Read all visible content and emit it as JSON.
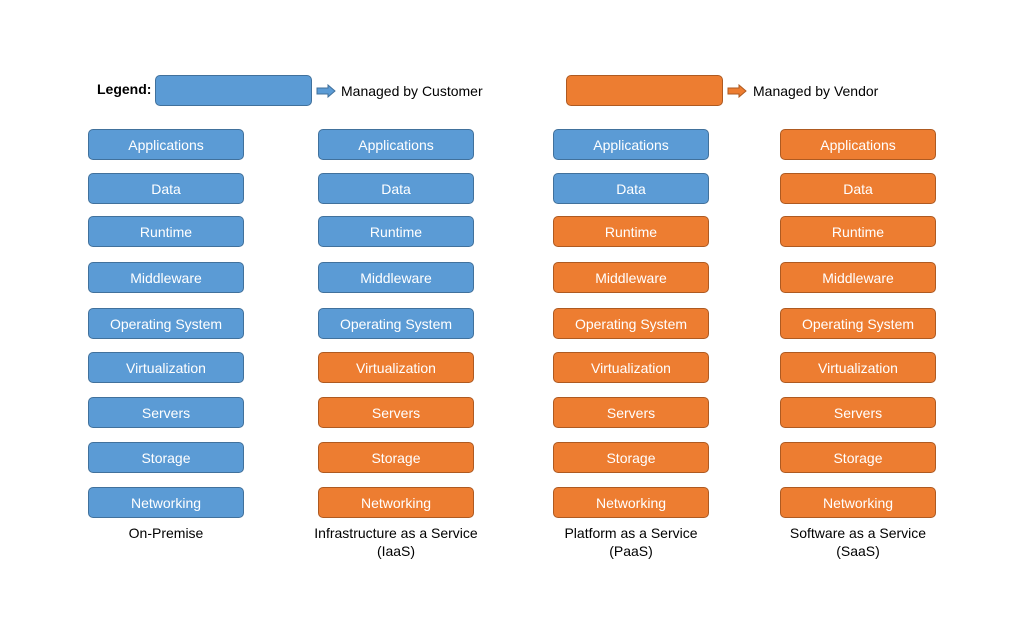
{
  "legend": {
    "label": "Legend:",
    "items": [
      {
        "text": "Managed by Customer",
        "color": "#5b9bd5",
        "border": "#41719c",
        "kind": "customer"
      },
      {
        "text": "Managed by Vendor",
        "color": "#ed7d31",
        "border": "#ae5a21",
        "kind": "vendor"
      }
    ]
  },
  "layers": [
    "Applications",
    "Data",
    "Runtime",
    "Middleware",
    "Operating System",
    "Virtualization",
    "Servers",
    "Storage",
    "Networking"
  ],
  "columns": [
    {
      "title": "On-Premise",
      "subtitle": "",
      "managed": [
        "customer",
        "customer",
        "customer",
        "customer",
        "customer",
        "customer",
        "customer",
        "customer",
        "customer"
      ]
    },
    {
      "title": "Infrastructure as a Service",
      "subtitle": "(IaaS)",
      "managed": [
        "customer",
        "customer",
        "customer",
        "customer",
        "customer",
        "vendor",
        "vendor",
        "vendor",
        "vendor"
      ]
    },
    {
      "title": "Platform as a Service",
      "subtitle": "(PaaS)",
      "managed": [
        "customer",
        "customer",
        "vendor",
        "vendor",
        "vendor",
        "vendor",
        "vendor",
        "vendor",
        "vendor"
      ]
    },
    {
      "title": "Software as a Service",
      "subtitle": "(SaaS)",
      "managed": [
        "vendor",
        "vendor",
        "vendor",
        "vendor",
        "vendor",
        "vendor",
        "vendor",
        "vendor",
        "vendor"
      ]
    }
  ]
}
